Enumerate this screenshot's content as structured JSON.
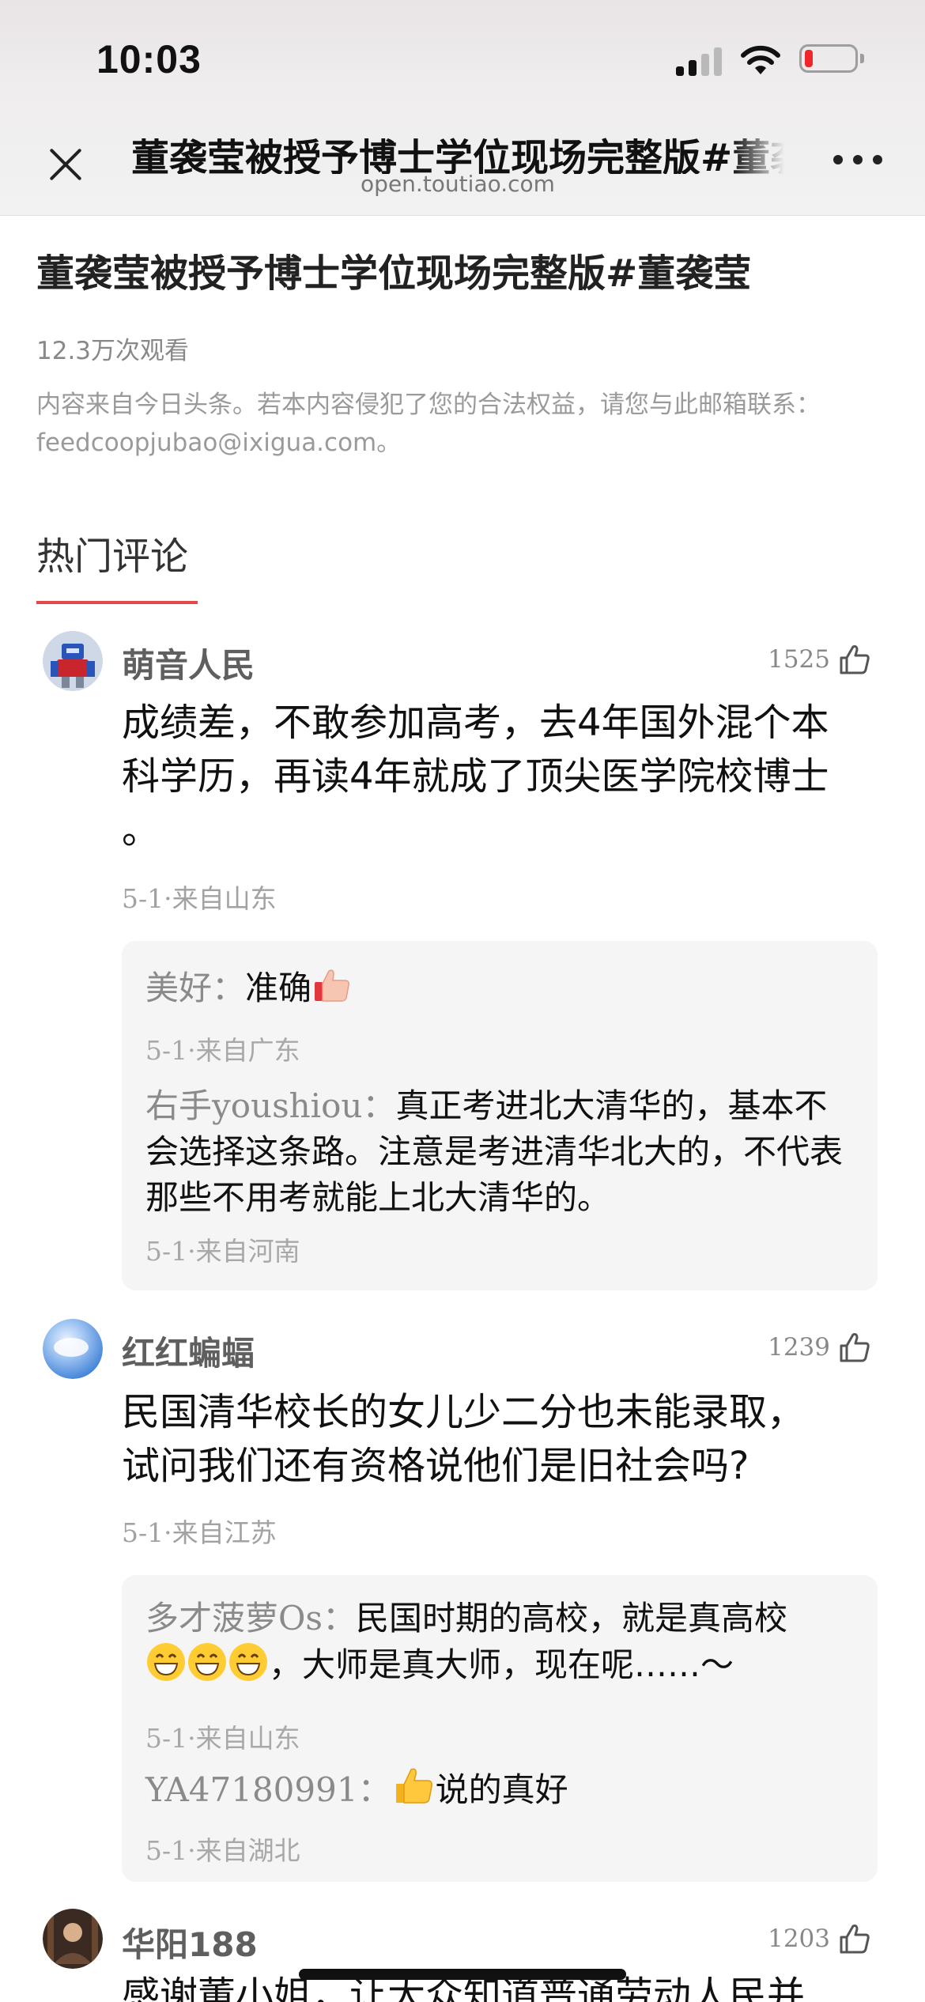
{
  "status": {
    "time": "10:03"
  },
  "header": {
    "title": "董袭莹被授予博士学位现场完整版#董袭莹",
    "url": "open.toutiao.com"
  },
  "article": {
    "title": "董袭莹被授予博士学位现场完整版#董袭莹",
    "views": "12.3万次观看",
    "notice": "内容来自今日头条。若本内容侵犯了您的合法权益，请您与此邮箱联系：feedcoopjubao@ixigua.com。"
  },
  "section": {
    "title": "热门评论"
  },
  "comments": [
    {
      "user": "萌音人民",
      "likes": "1525",
      "text_line1": "成绩差，不敢参加高考，去4年国外混个本",
      "text_line2": "科学历，再读4年就成了顶尖医学院校博士",
      "text_line3": "。",
      "date": "5-1·",
      "location": "来自山东",
      "replies": [
        {
          "name": "美好：",
          "text": "准确",
          "date": "5-1·",
          "location": "来自广东"
        },
        {
          "name": "右手youshiou：",
          "text": "真正考进北大清华的，基本不会选择这条路。注意是考进清华北大的，不代表那些不用考就能上北大清华的。",
          "date": "5-1·",
          "location": "来自河南"
        }
      ]
    },
    {
      "user": "红红蝙蝠",
      "likes": "1239",
      "text_line1": "民国清华校长的女儿少二分也未能录取，",
      "text_line2": "试问我们还有资格说他们是旧社会吗?",
      "date": "5-1·",
      "location": "来自江苏",
      "replies": [
        {
          "name": "多才菠萝Os：",
          "text_a": "民国时期的高校，就是真高校",
          "text_b": "，大师是真大师，现在呢……～",
          "date": "5-1·",
          "location": "来自山东"
        },
        {
          "name": "YA47180991：",
          "text": "说的真好",
          "date": "5-1·",
          "location": "来自湖北"
        }
      ]
    },
    {
      "user": "华阳188",
      "likes": "1203",
      "text_line1": "感谢董小姐，让大众知道普通劳动人民并"
    }
  ],
  "icons": {
    "close": "close-icon",
    "more": "more-dots-icon",
    "like": "thumbs-up-icon",
    "signal": "cellular-signal-icon",
    "wifi": "wifi-icon",
    "battery": "battery-low-icon"
  },
  "colors": {
    "accent_red": "#e8474a",
    "battery_low": "#f0262c"
  }
}
